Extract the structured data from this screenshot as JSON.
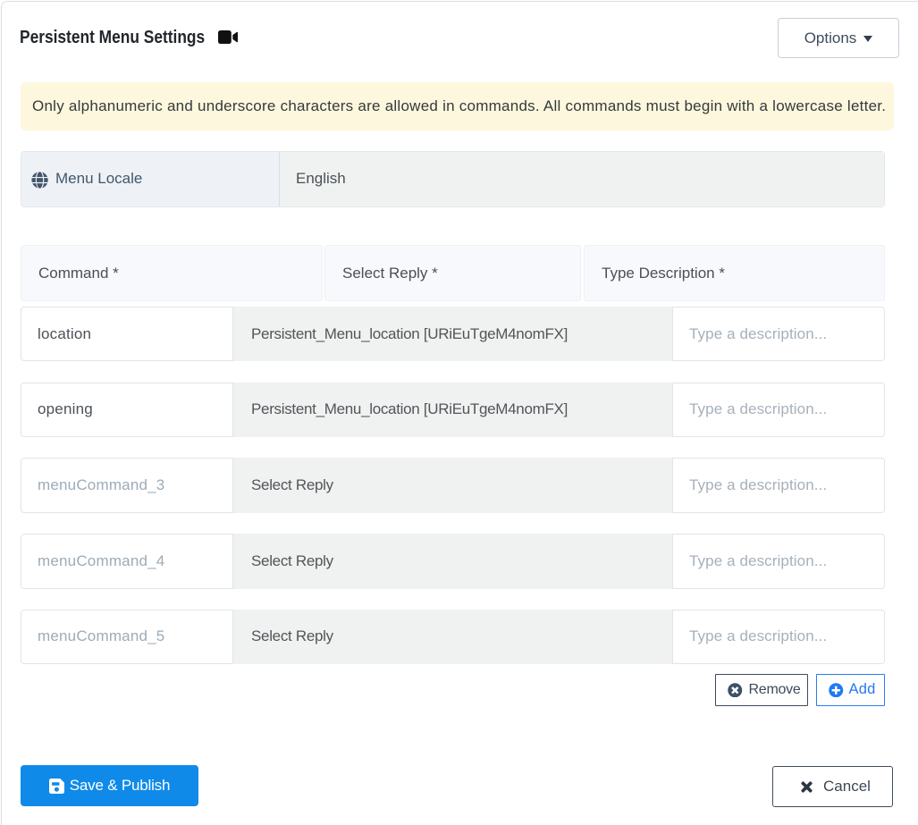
{
  "header": {
    "title": "Persistent Menu Settings",
    "options_label": "Options"
  },
  "alert": {
    "text": "Only alphanumeric and underscore characters are allowed in commands. All commands must begin with a lowercase letter."
  },
  "menu_locale": {
    "label": "Menu Locale",
    "value": "English"
  },
  "table": {
    "headers": {
      "command": "Command *",
      "reply": "Select Reply *",
      "description": "Type Description *"
    },
    "rows": [
      {
        "command_value": "location",
        "command_placeholder": "",
        "reply": "Persistent_Menu_location [URiEuTgeM4nomFX]",
        "description_value": "",
        "description_placeholder": "Type a description..."
      },
      {
        "command_value": "opening",
        "command_placeholder": "",
        "reply": "Persistent_Menu_location [URiEuTgeM4nomFX]",
        "description_value": "",
        "description_placeholder": "Type a description..."
      },
      {
        "command_value": "",
        "command_placeholder": "menuCommand_3",
        "reply": "Select Reply",
        "description_value": "",
        "description_placeholder": "Type a description..."
      },
      {
        "command_value": "",
        "command_placeholder": "menuCommand_4",
        "reply": "Select Reply",
        "description_value": "",
        "description_placeholder": "Type a description..."
      },
      {
        "command_value": "",
        "command_placeholder": "menuCommand_5",
        "reply": "Select Reply",
        "description_value": "",
        "description_placeholder": "Type a description..."
      }
    ],
    "remove_label": "Remove",
    "add_label": "Add"
  },
  "footer": {
    "save_label": "Save & Publish",
    "cancel_label": "Cancel"
  },
  "colors": {
    "primary_blue": "#0f8ae9",
    "add_blue": "#2577ef",
    "slate": "#3e4b5b",
    "alert_bg": "#fdf7dd"
  }
}
